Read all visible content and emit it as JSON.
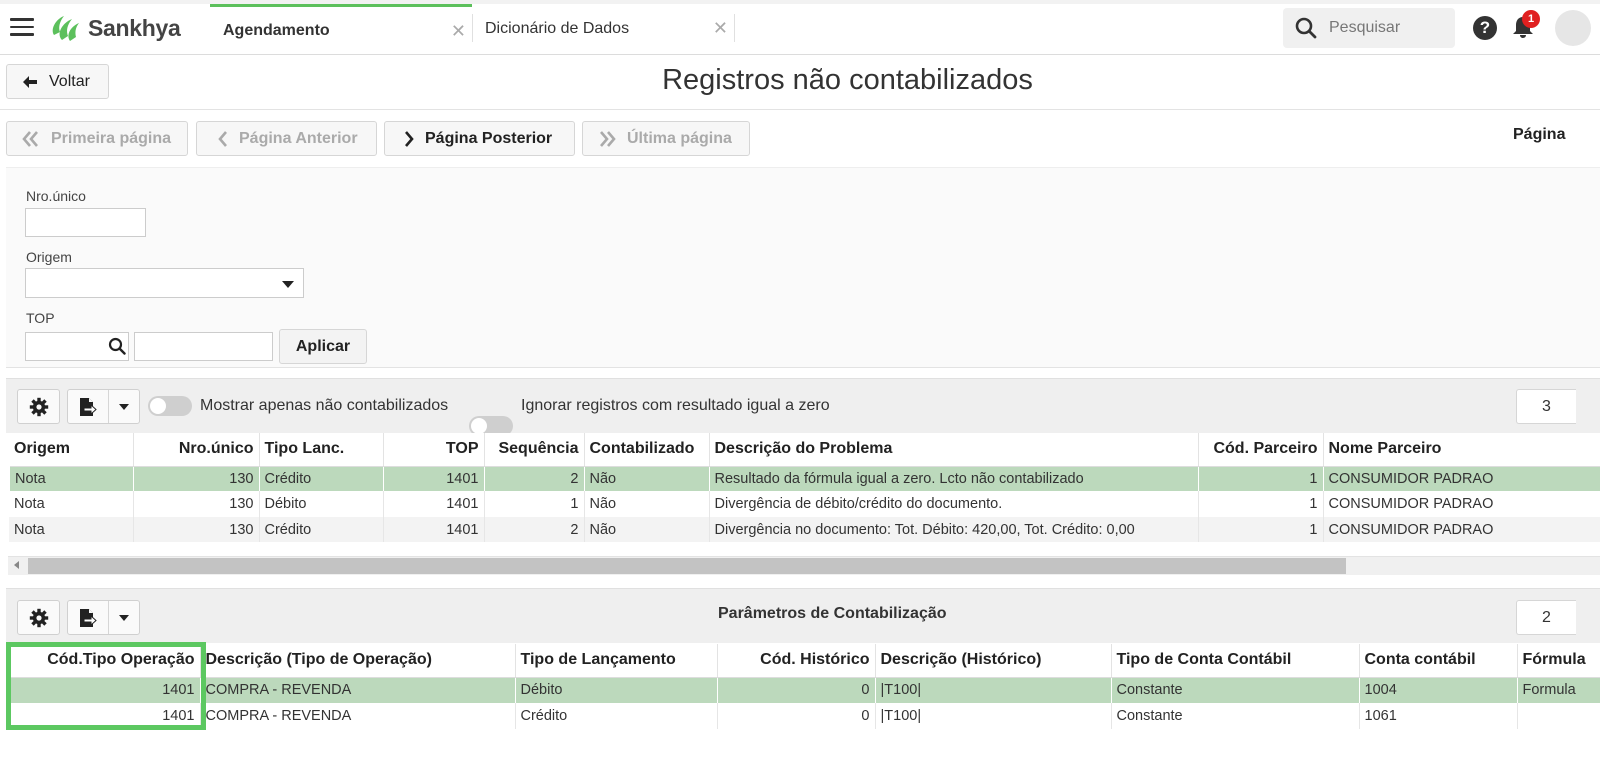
{
  "app": {
    "logo_text": "Sankhya"
  },
  "tabs": [
    {
      "label": "Agendamento",
      "active": true
    },
    {
      "label": "Dicionário de Dados",
      "active": false
    }
  ],
  "topbar": {
    "search_placeholder": "Pesquisar",
    "notification_count": "1",
    "help_symbol": "?"
  },
  "header": {
    "back_label": "Voltar",
    "title": "Registros não contabilizados"
  },
  "pagination": {
    "first": "Primeira página",
    "prev": "Página Anterior",
    "next": "Página Posterior",
    "last": "Última página",
    "page_label": "Página"
  },
  "filters": {
    "nro_unico_label": "Nro.único",
    "origem_label": "Origem",
    "top_label": "TOP",
    "apply_label": "Aplicar"
  },
  "grid1": {
    "toggle1_label": "Mostrar apenas não contabilizados",
    "toggle2_label": "Ignorar registros com resultado igual a zero",
    "count": "3",
    "columns": [
      "Origem",
      "Nro.único",
      "Tipo Lanc.",
      "TOP",
      "Sequência",
      "Contabilizado",
      "Descrição do Problema",
      "Cód. Parceiro",
      "Nome Parceiro"
    ],
    "rows": [
      [
        "Nota",
        "130",
        "Crédito",
        "1401",
        "2",
        "Não",
        "Resultado da fórmula igual a zero. Lcto não contabilizado",
        "1",
        "CONSUMIDOR PADRAO"
      ],
      [
        "Nota",
        "130",
        "Débito",
        "1401",
        "1",
        "Não",
        "Divergência de débito/crédito do documento.",
        "1",
        "CONSUMIDOR PADRAO"
      ],
      [
        "Nota",
        "130",
        "Crédito",
        "1401",
        "2",
        "Não",
        "Divergência no documento: Tot. Débito: 420,00, Tot. Crédito: 0,00",
        "1",
        "CONSUMIDOR PADRAO"
      ]
    ]
  },
  "grid2": {
    "title": "Parâmetros de Contabilização",
    "count": "2",
    "columns": [
      "Cód.Tipo Operação",
      "Descrição (Tipo de Operação)",
      "Tipo de Lançamento",
      "Cód. Histórico",
      "Descrição (Histórico)",
      "Tipo de Conta Contábil",
      "Conta contábil",
      "Fórmula"
    ],
    "rows": [
      [
        "1401",
        "COMPRA - REVENDA",
        "Débito",
        "0",
        "|T100|",
        "Constante",
        "1004",
        "Formula"
      ],
      [
        "1401",
        "COMPRA - REVENDA",
        "Crédito",
        "0",
        "|T100|",
        "Constante",
        "1061",
        ""
      ]
    ]
  },
  "colors": {
    "accent": "#5cc05c",
    "selected_row": "#bcd9bc",
    "highlight_box": "#5cc861"
  }
}
